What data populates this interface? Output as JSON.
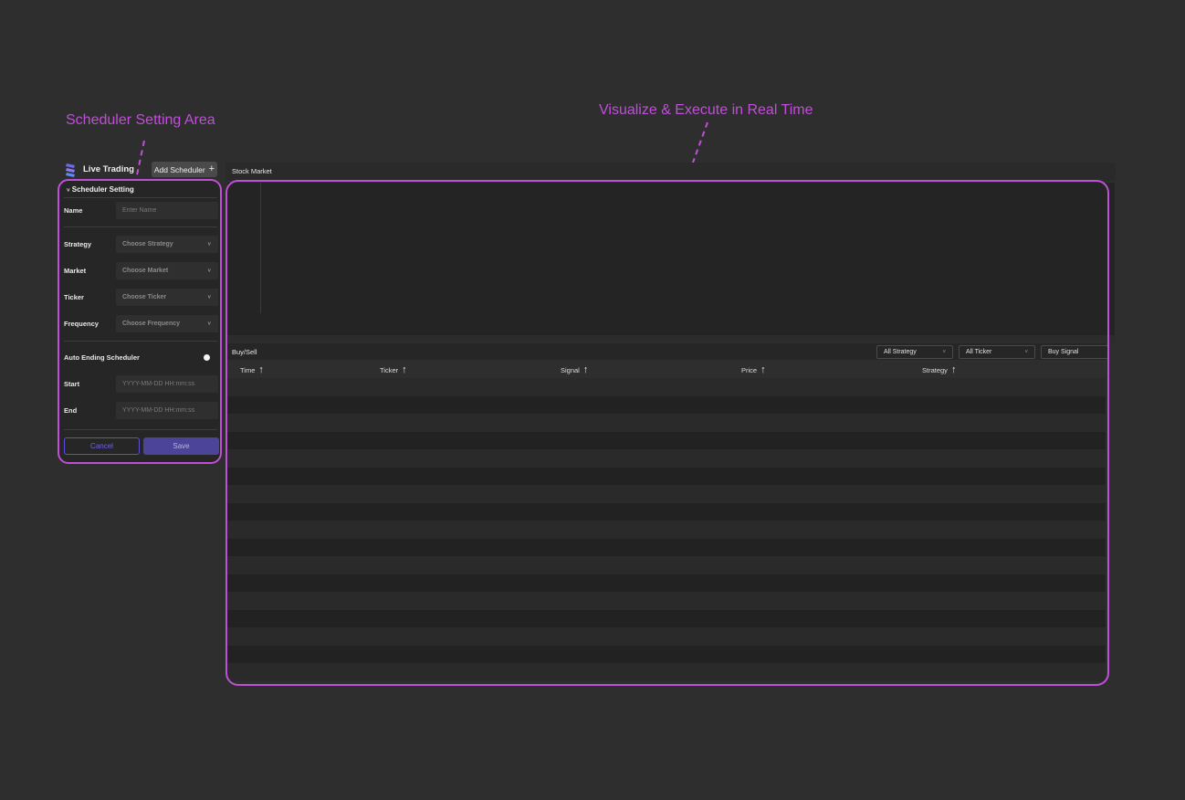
{
  "annotations": {
    "left": "Scheduler Setting Area",
    "right": "Visualize & Execute in Real Time"
  },
  "header": {
    "app_title": "Live Trading",
    "add_scheduler_label": "Add Scheduler",
    "add_icon": "+"
  },
  "scheduler": {
    "section_title": "Scheduler Setting",
    "collapse_icon": "˅",
    "name": {
      "label": "Name",
      "placeholder": "Enter Name"
    },
    "strategy": {
      "label": "Strategy",
      "value": "Choose Strategy"
    },
    "market": {
      "label": "Market",
      "value": "Choose Market"
    },
    "ticker": {
      "label": "Ticker",
      "value": "Choose Ticker"
    },
    "frequency": {
      "label": "Frequency",
      "value": "Choose Frequency"
    },
    "auto_ending_label": "Auto Ending Scheduler",
    "start": {
      "label": "Start",
      "placeholder": "YYYY-MM-DD HH:mm:ss"
    },
    "end": {
      "label": "End",
      "placeholder": "YYYY-MM-DD HH:mm:ss"
    },
    "cancel_label": "Cancel",
    "save_label": "Save"
  },
  "main": {
    "chart_title": "Stock Market",
    "buysell_title": "Buy/Sell",
    "filters": {
      "strategy": "All Strategy",
      "ticker": "All Ticker",
      "signal": "Buy Signal"
    },
    "columns": [
      "Time",
      "Ticker",
      "Signal",
      "Price",
      "Strategy"
    ],
    "sort_icon": "↑",
    "caret_icon": "˅"
  },
  "colors": {
    "annotation": "#c04fd8",
    "accent": "#5b4fd8",
    "background": "#2e2e2e"
  }
}
